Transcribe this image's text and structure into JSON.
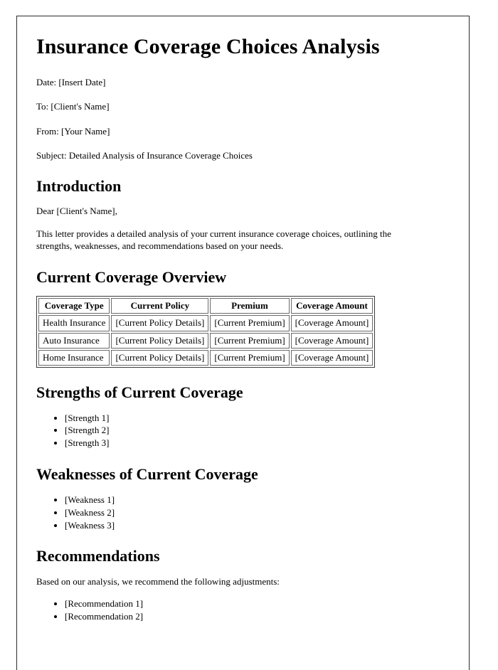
{
  "document": {
    "title": "Insurance Coverage Choices Analysis",
    "meta_lines": [
      "Date: [Insert Date]",
      "To: [Client's Name]",
      "From: [Your Name]",
      "Subject: Detailed Analysis of Insurance Coverage Choices"
    ],
    "introduction": {
      "heading": "Introduction",
      "salutation": "Dear [Client's Name],",
      "paragraph": "This letter provides a detailed analysis of your current insurance coverage choices, outlining the strengths, weaknesses, and recommendations based on your needs."
    },
    "coverage_overview": {
      "heading": "Current Coverage Overview",
      "table": {
        "columns": [
          "Coverage Type",
          "Current Policy",
          "Premium",
          "Coverage Amount"
        ],
        "rows": [
          [
            "Health Insurance",
            "[Current Policy Details]",
            "[Current Premium]",
            "[Coverage Amount]"
          ],
          [
            "Auto Insurance",
            "[Current Policy Details]",
            "[Current Premium]",
            "[Coverage Amount]"
          ],
          [
            "Home Insurance",
            "[Current Policy Details]",
            "[Current Premium]",
            "[Coverage Amount]"
          ]
        ]
      }
    },
    "strengths": {
      "heading": "Strengths of Current Coverage",
      "items": [
        "[Strength 1]",
        "[Strength 2]",
        "[Strength 3]"
      ]
    },
    "weaknesses": {
      "heading": "Weaknesses of Current Coverage",
      "items": [
        "[Weakness 1]",
        "[Weakness 2]",
        "[Weakness 3]"
      ]
    },
    "recommendations": {
      "heading": "Recommendations",
      "intro": "Based on our analysis, we recommend the following adjustments:",
      "items": [
        "[Recommendation 1]",
        "[Recommendation 2]"
      ]
    }
  }
}
